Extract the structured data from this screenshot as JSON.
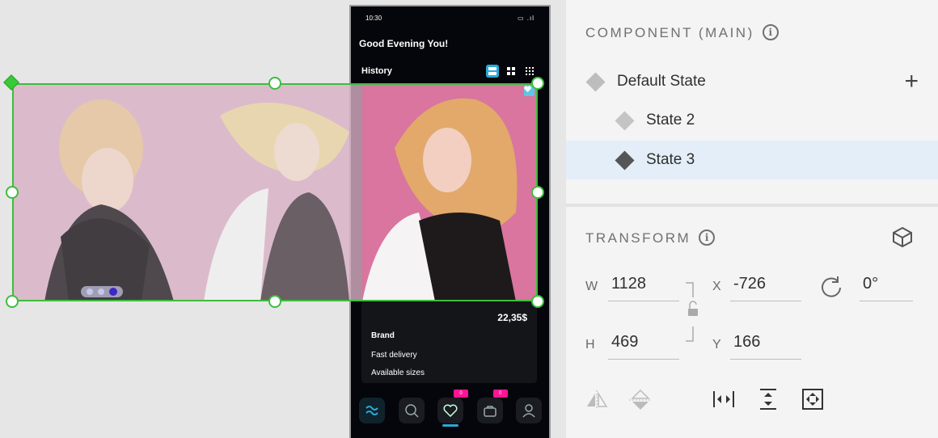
{
  "phone": {
    "status_time": "10:30",
    "status_icons": "▭ .ıl",
    "greeting": "Good Evening You!",
    "history_label": "History",
    "product": {
      "price": "22,35$",
      "brand": "Brand",
      "delivery": "Fast delivery",
      "sizes": "Available sizes"
    },
    "nav": {
      "likes_badge": "0",
      "cart_badge": "0"
    },
    "pager": {
      "pages": 3,
      "current": 3
    }
  },
  "panel": {
    "component_title": "COMPONENT (MAIN)",
    "states": [
      {
        "label": "Default State",
        "selected": false,
        "color": "#bdbdbd"
      },
      {
        "label": "State 2",
        "selected": false,
        "color": "#c4c4c4"
      },
      {
        "label": "State 3",
        "selected": true,
        "color": "#555555"
      }
    ],
    "transform_title": "TRANSFORM",
    "transform": {
      "w_label": "W",
      "w_value": "1128",
      "h_label": "H",
      "h_value": "469",
      "x_label": "X",
      "x_value": "-726",
      "y_label": "Y",
      "y_value": "166",
      "rotation_value": "0°"
    }
  },
  "colors": {
    "selection": "#3dbd3d",
    "accent": "#29a9d8",
    "badge": "#ff1493",
    "selected_row": "#e4eef8"
  }
}
